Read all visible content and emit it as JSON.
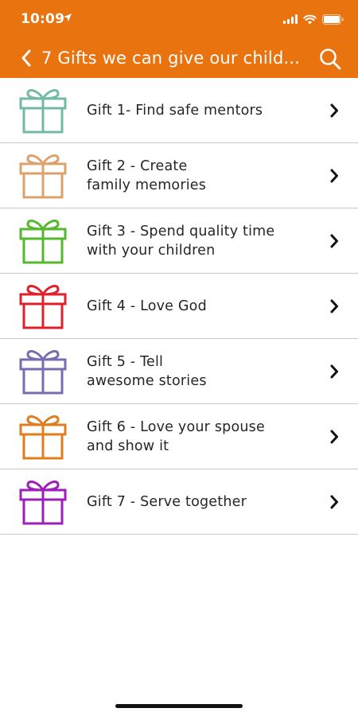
{
  "status_bar": {
    "time": "10:09"
  },
  "nav": {
    "title": "7 Gifts we can give our child..."
  },
  "gifts": [
    {
      "line1": "Gift 1- Find safe mentors",
      "line2": "",
      "color": "#74b9a5"
    },
    {
      "line1": "Gift 2 - Create",
      "line2": "family memories",
      "color": "#dba26e"
    },
    {
      "line1": "Gift 3 - Spend quality time",
      "line2": "with your children",
      "color": "#56b82f"
    },
    {
      "line1": "Gift 4 - Love God",
      "line2": "",
      "color": "#e0202c"
    },
    {
      "line1": "Gift 5 - Tell",
      "line2": "awesome stories",
      "color": "#7a6cb3"
    },
    {
      "line1": "Gift 6 - Love your spouse",
      "line2": "and show it",
      "color": "#e07d1e"
    },
    {
      "line1": "Gift 7 - Serve together",
      "line2": "",
      "color": "#9b1fb8"
    }
  ],
  "icons": {
    "back": "chevron-left-icon",
    "search": "search-icon",
    "row_icon": "gift-box-icon",
    "row_action": "chevron-right-icon"
  },
  "colors": {
    "header": "#e8730f",
    "separator": "#c8c8c8",
    "text": "#262626"
  }
}
